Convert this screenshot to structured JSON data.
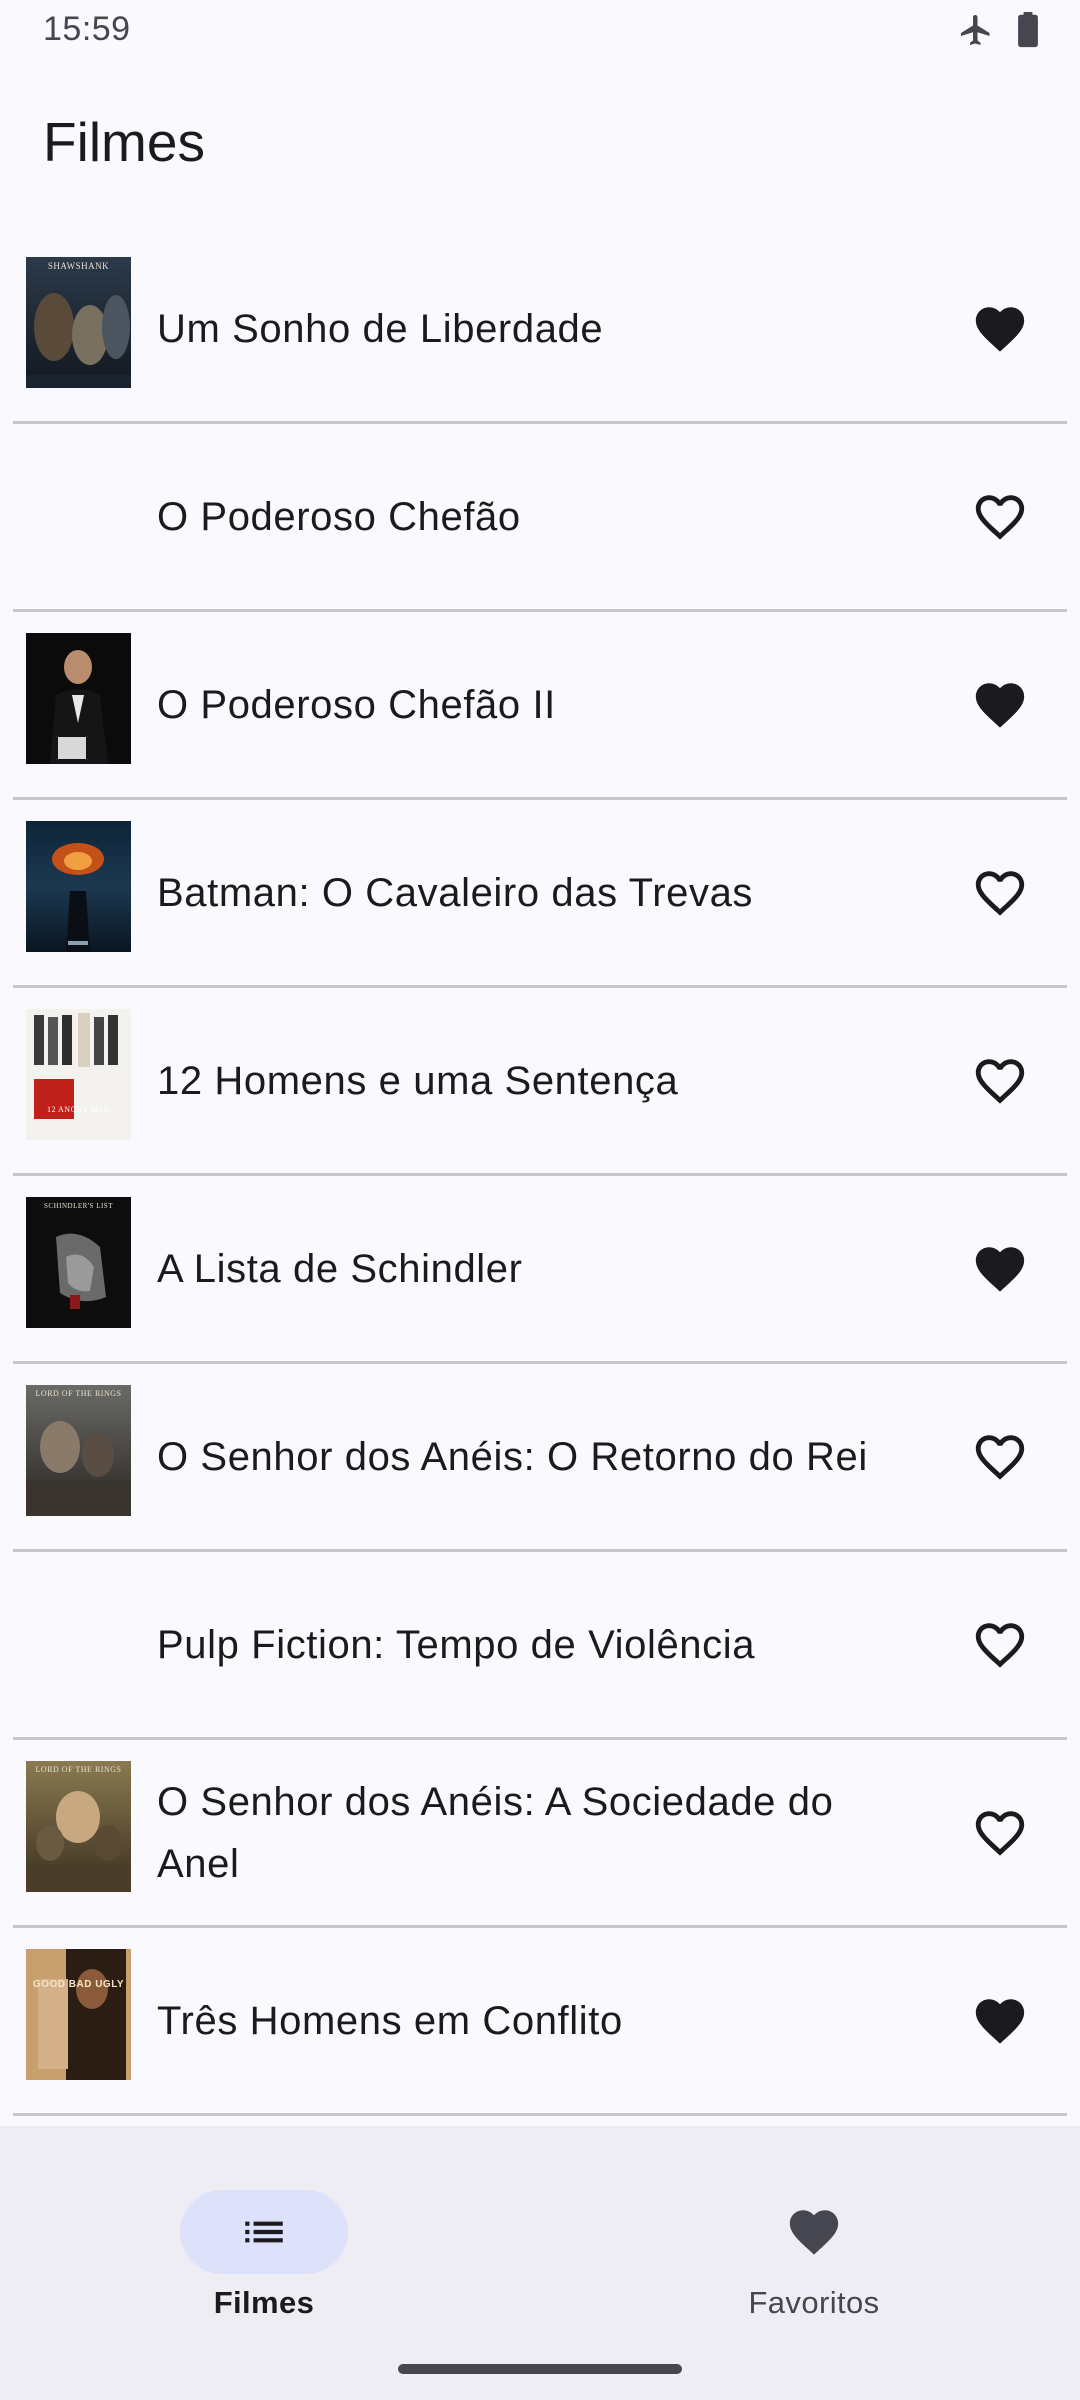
{
  "status": {
    "time": "15:59",
    "icons": [
      "airplane-mode-icon",
      "battery-icon"
    ]
  },
  "app": {
    "title": "Filmes"
  },
  "movies": [
    {
      "title": "Um Sonho de Liberdade",
      "favorite": true,
      "poster": "shawshank",
      "poster_text": "SHAWSHANK"
    },
    {
      "title": "O Poderoso Chefão",
      "favorite": false,
      "poster": "none",
      "poster_text": ""
    },
    {
      "title": "O Poderoso Chefão II",
      "favorite": true,
      "poster": "godfather2",
      "poster_text": ""
    },
    {
      "title": "Batman: O Cavaleiro das Trevas",
      "favorite": false,
      "poster": "darkknight",
      "poster_text": ""
    },
    {
      "title": "12 Homens e uma Sentença",
      "favorite": false,
      "poster": "12angrymen",
      "poster_text": "12 ANGRY MEN"
    },
    {
      "title": "A Lista de Schindler",
      "favorite": true,
      "poster": "schindler",
      "poster_text": "SCHINDLER'S LIST"
    },
    {
      "title": "O Senhor dos Anéis: O Retorno do Rei",
      "favorite": false,
      "poster": "lotr3",
      "poster_text": "LORD OF THE RINGS"
    },
    {
      "title": "Pulp Fiction: Tempo de Violência",
      "favorite": false,
      "poster": "none",
      "poster_text": ""
    },
    {
      "title": "O Senhor dos Anéis: A Sociedade do Anel",
      "favorite": false,
      "poster": "lotr1",
      "poster_text": "LORD OF THE RINGS"
    },
    {
      "title": "Três Homens em Conflito",
      "favorite": true,
      "poster": "gbu",
      "poster_text": "GOOD BAD UGLY"
    }
  ],
  "bottom_nav": {
    "items": [
      {
        "label": "Filmes",
        "icon": "list-icon",
        "active": true
      },
      {
        "label": "Favoritos",
        "icon": "heart-icon",
        "active": false
      }
    ]
  },
  "colors": {
    "background": "#f9f9fe",
    "nav_background": "#eeedf4",
    "nav_indicator": "#dde1fa",
    "text": "#1b1b1f",
    "divider": "#c6c6cc"
  }
}
